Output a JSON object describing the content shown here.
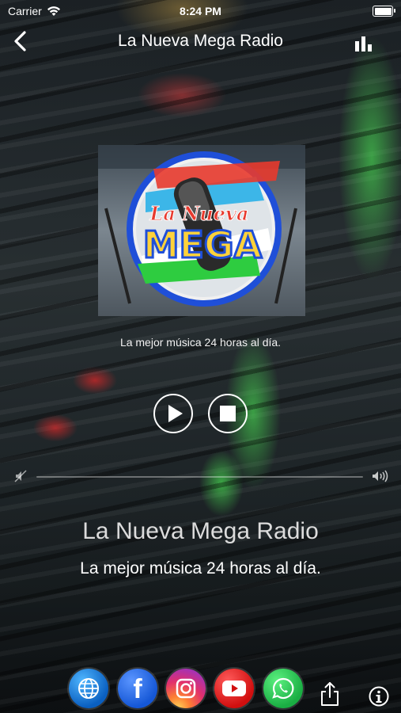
{
  "status_bar": {
    "carrier": "Carrier",
    "time": "8:24 PM"
  },
  "nav": {
    "title": "La Nueva Mega Radio"
  },
  "artwork": {
    "logo_script": "La Nueva",
    "logo_main": "MEGA"
  },
  "player": {
    "tagline": "La mejor música 24 horas al día.",
    "volume_level": 0
  },
  "station": {
    "name": "La Nueva Mega Radio",
    "tagline": "La mejor música 24 horas al día."
  },
  "social": {
    "icons": [
      "globe-icon",
      "facebook-icon",
      "instagram-icon",
      "youtube-icon",
      "whatsapp-icon"
    ],
    "facebook_glyph": "f"
  },
  "colors": {
    "accent_green": "#3cff4a",
    "logo_yellow": "#ffd23a",
    "logo_red": "#e83a2e",
    "logo_blue": "#1f4fd8"
  }
}
